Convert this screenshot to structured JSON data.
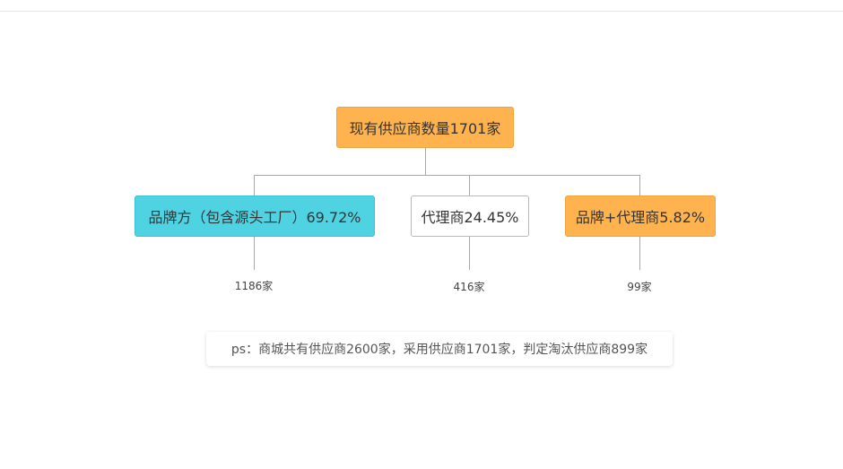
{
  "root": {
    "label": "现有供应商数量1701家",
    "color": "#ffb34f"
  },
  "children": [
    {
      "label": "品牌方（包含源头工厂）69.72%",
      "count": "1186家",
      "color": "#4fd3e3"
    },
    {
      "label": "代理商24.45%",
      "count": "416家",
      "color": "#ffffff"
    },
    {
      "label": "品牌+代理商5.82%",
      "count": "99家",
      "color": "#ffb34f"
    }
  ],
  "note": "ps：商城共有供应商2600家，采用供应商1701家，判定淘汰供应商899家",
  "colors": {
    "orange": "#ffb34f",
    "cyan": "#4fd3e3",
    "line": "#a8a8a8"
  }
}
